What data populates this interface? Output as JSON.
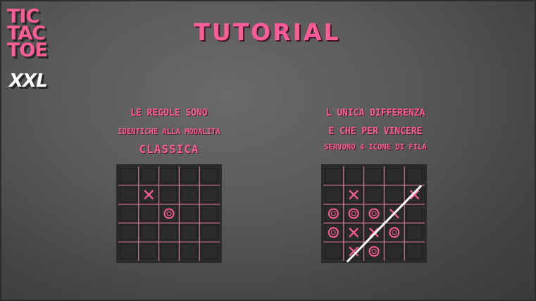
{
  "logo": {
    "line1": "TIC",
    "line2": "TAC",
    "line3": "TOE",
    "badge": "XXL"
  },
  "title": "TUTORIAL",
  "left_panel": {
    "line1": "LE REGOLE SONO",
    "line2": "IDENTICHE ALLA MODALITA",
    "line3": "CLASSICA",
    "board": [
      [
        "",
        "",
        "",
        "",
        ""
      ],
      [
        "",
        "X",
        "",
        "",
        ""
      ],
      [
        "",
        "",
        "O",
        "",
        ""
      ],
      [
        "",
        "",
        "",
        "",
        ""
      ],
      [
        "",
        "",
        "",
        "",
        ""
      ]
    ]
  },
  "right_panel": {
    "line1": "L UNICA DIFFERENZA",
    "line2": "E CHE PER VINCERE",
    "line3": "SERVONO 4 ICONE DI FILA",
    "board": [
      [
        "",
        "",
        "",
        "",
        ""
      ],
      [
        "",
        "X",
        "",
        "",
        "X"
      ],
      [
        "O",
        "O",
        "O",
        "X",
        ""
      ],
      [
        "O",
        "X",
        "X",
        "O",
        ""
      ],
      [
        "",
        "X",
        "O",
        "",
        ""
      ]
    ],
    "winning_line": {
      "from": [
        4,
        1
      ],
      "to": [
        1,
        4
      ]
    }
  },
  "colors": {
    "accent": "#ff5c98",
    "cell": "#2b2b2b",
    "grid": "#ff8fb5",
    "board_bg": "#2a2a2a"
  },
  "icons": {
    "x_mark": "x-mark-icon",
    "o_mark": "o-mark-icon"
  }
}
